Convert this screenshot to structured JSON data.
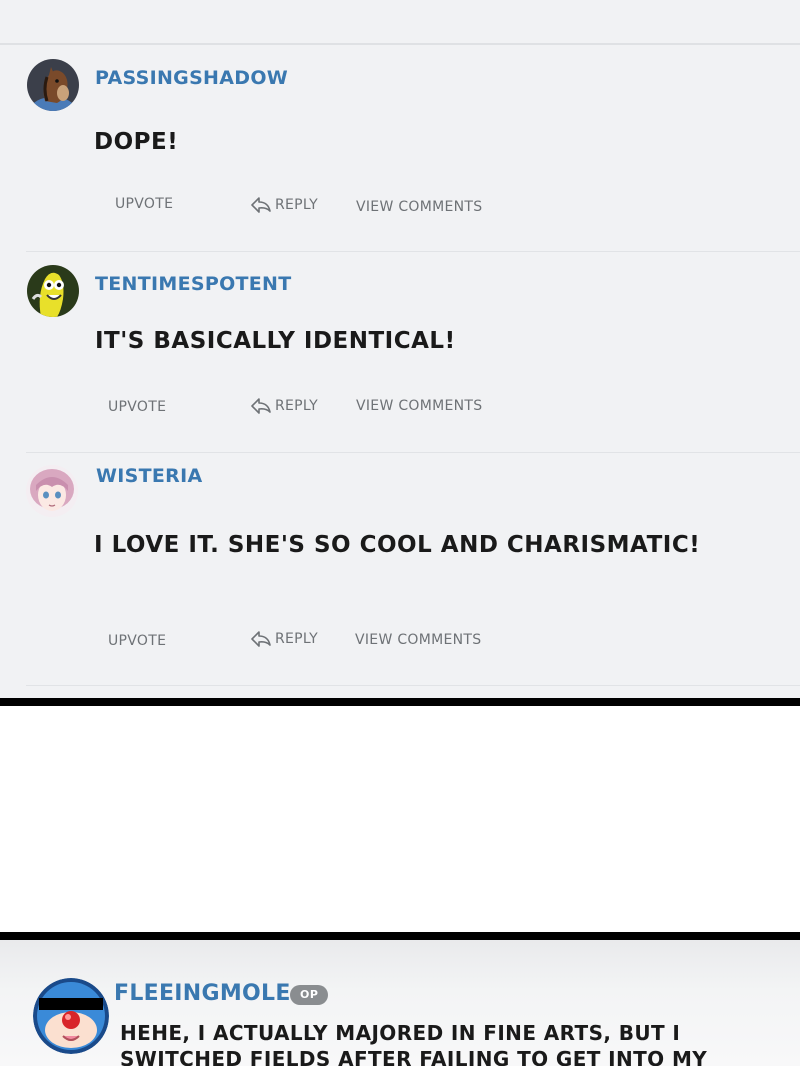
{
  "comments": [
    {
      "username": "PASSINGSHADOW",
      "text": "DOPE!",
      "upvote_label": "UPVOTE",
      "reply_label": "REPLY",
      "view_comments_label": "VIEW COMMENTS"
    },
    {
      "username": "TENTIMESPOTENT",
      "text": "IT'S BASICALLY IDENTICAL!",
      "upvote_label": "UPVOTE",
      "reply_label": "REPLY",
      "view_comments_label": "VIEW COMMENTS"
    },
    {
      "username": "WISTERIA",
      "text": "I LOVE IT. SHE'S SO COOL AND CHARISMATIC!",
      "upvote_label": "UPVOTE",
      "reply_label": "REPLY",
      "view_comments_label": "VIEW COMMENTS"
    }
  ],
  "op_comment": {
    "username": "FLEEINGMOLE",
    "badge": "OP",
    "text_line1": "HEHE, I ACTUALLY MAJORED IN FINE ARTS, BUT I",
    "text_line2": "SWITCHED FIELDS AFTER FAILING TO GET INTO MY"
  },
  "colors": {
    "username": "#3a78b0",
    "panel_bg": "#f1f2f4",
    "action_text": "#6e7276"
  },
  "icons": [
    "horse-avatar-icon",
    "banana-avatar-icon",
    "anime-girl-avatar-icon",
    "mole-avatar-icon",
    "reply-arrow-icon"
  ]
}
